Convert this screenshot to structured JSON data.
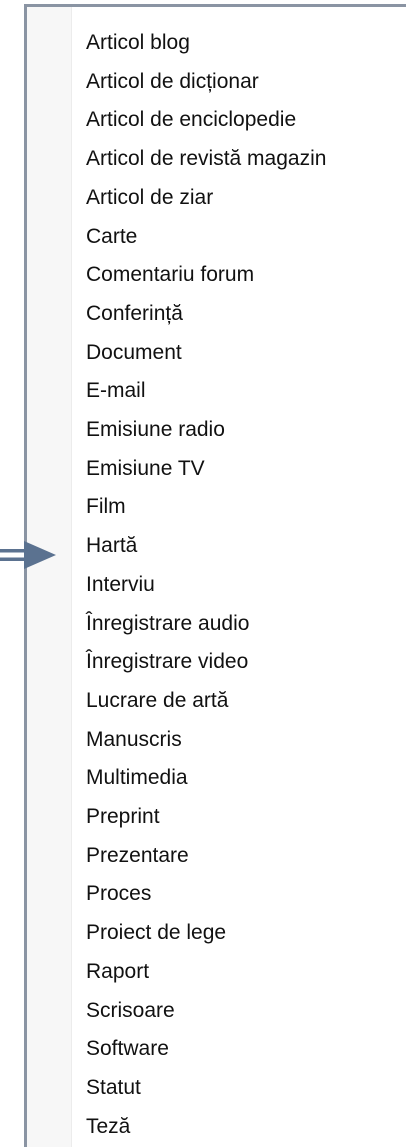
{
  "menu": {
    "items": [
      {
        "label": "Articol blog"
      },
      {
        "label": "Articol de dicționar"
      },
      {
        "label": "Articol de enciclopedie"
      },
      {
        "label": "Articol de revistă magazin"
      },
      {
        "label": "Articol de ziar"
      },
      {
        "label": "Carte"
      },
      {
        "label": "Comentariu forum"
      },
      {
        "label": "Conferință"
      },
      {
        "label": "Document"
      },
      {
        "label": "E-mail"
      },
      {
        "label": "Emisiune radio"
      },
      {
        "label": "Emisiune TV"
      },
      {
        "label": "Film"
      },
      {
        "label": "Hartă"
      },
      {
        "label": "Interviu"
      },
      {
        "label": "Înregistrare audio"
      },
      {
        "label": "Înregistrare video"
      },
      {
        "label": "Lucrare de artă"
      },
      {
        "label": "Manuscris"
      },
      {
        "label": "Multimedia"
      },
      {
        "label": "Preprint"
      },
      {
        "label": "Prezentare"
      },
      {
        "label": "Proces"
      },
      {
        "label": "Proiect de lege"
      },
      {
        "label": "Raport"
      },
      {
        "label": "Scrisoare"
      },
      {
        "label": "Software"
      },
      {
        "label": "Statut"
      },
      {
        "label": "Teză"
      }
    ]
  },
  "pointer": {
    "icon": "right-arrow-icon",
    "color": "#5b7290"
  },
  "colors": {
    "panel_border": "#8a94a3",
    "text": "#111111"
  }
}
